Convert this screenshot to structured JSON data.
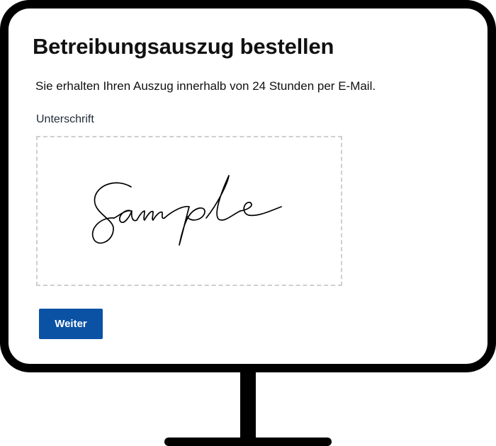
{
  "page": {
    "title": "Betreibungsauszug bestellen",
    "intro": "Sie erhalten Ihren Auszug innerhalb von 24 Stunden per E-Mail."
  },
  "signature": {
    "label": "Unterschrift",
    "drawn_text": "Sample"
  },
  "actions": {
    "continue_label": "Weiter"
  },
  "colors": {
    "primary_button": "#0b52a5",
    "frame": "#000000",
    "pad_border": "#cfcfcf"
  }
}
